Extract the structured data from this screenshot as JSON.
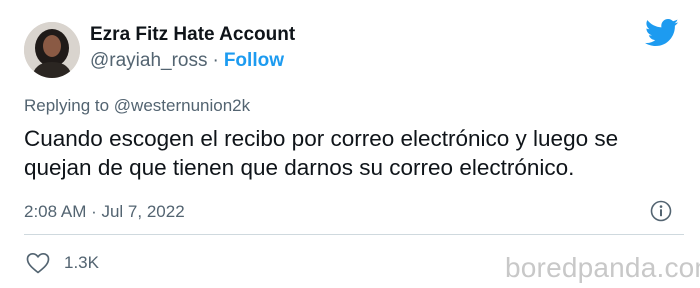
{
  "tweet": {
    "display_name": "Ezra Fitz Hate Account",
    "handle": "@rayiah_ross",
    "separator": "·",
    "follow_label": "Follow",
    "reply_prefix": "Replying to ",
    "reply_mention": "@westernunion2k",
    "text": "Cuando escogen el recibo por correo electrónico y luego se quejan de que tienen que darnos su correo electrónico.",
    "timestamp": "2:08 AM · Jul 7, 2022",
    "like_count": "1.3K"
  },
  "icons": {
    "brand": "twitter-bird-icon",
    "info": "info-icon",
    "like": "heart-icon"
  },
  "watermark": "boredpanda.com",
  "colors": {
    "accent": "#1d9bf0",
    "text_primary": "#0f1419",
    "text_secondary": "#536471",
    "divider": "#cfd9de",
    "watermark": "#c8c8c8"
  }
}
